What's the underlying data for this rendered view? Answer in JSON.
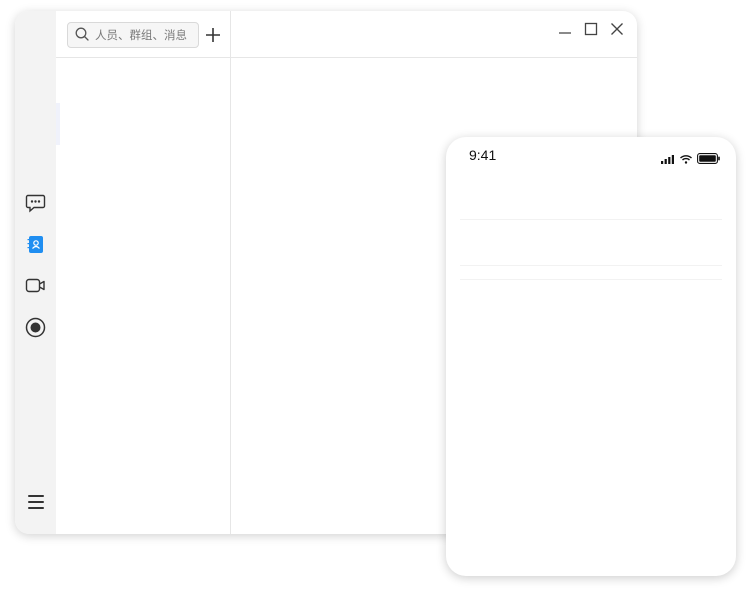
{
  "app": {
    "search": {
      "placeholder": "人员、群组、消息",
      "value": ""
    },
    "sidebar": {
      "items": [
        {
          "name": "messages",
          "icon": "chat-bubble-icon",
          "active": false
        },
        {
          "name": "contacts",
          "icon": "contacts-book-icon",
          "active": true
        },
        {
          "name": "meetings",
          "icon": "video-camera-icon",
          "active": false
        },
        {
          "name": "live",
          "icon": "record-icon",
          "active": false
        }
      ],
      "menu_icon": "hamburger-menu-icon"
    },
    "window_controls": [
      "minimize-icon",
      "maximize-icon",
      "close-icon"
    ],
    "colors": {
      "accent": "#1f8ef1",
      "sidebar_bg": "#f3f3f3",
      "icon": "#333333"
    }
  },
  "phone": {
    "status_bar": {
      "time": "9:41",
      "icons": [
        "signal-icon",
        "wifi-icon",
        "battery-icon"
      ]
    }
  }
}
